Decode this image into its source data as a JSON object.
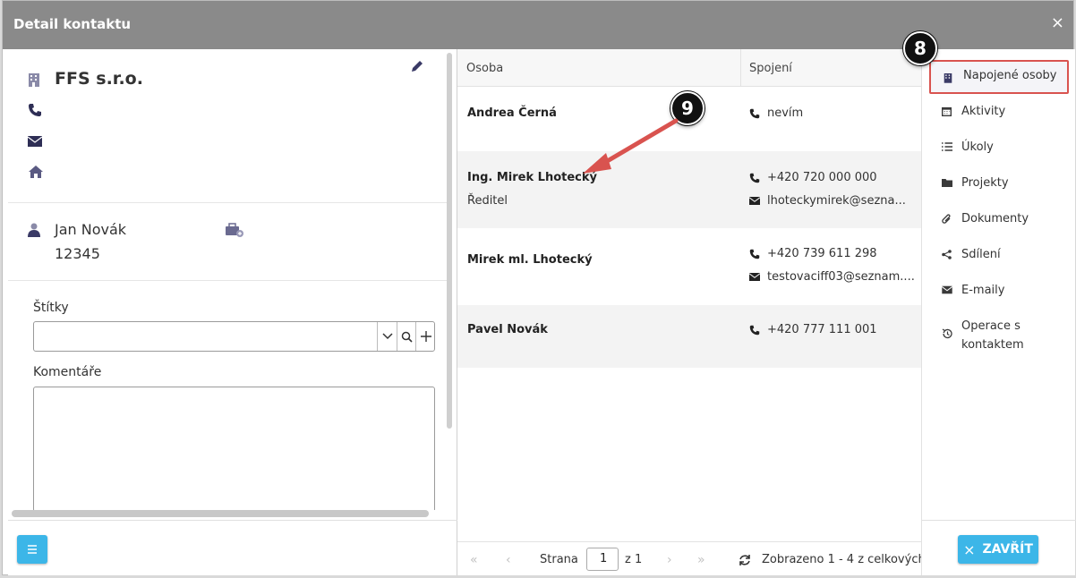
{
  "dialog": {
    "title": "Detail kontaktu",
    "close_symbol": "×"
  },
  "company": {
    "name": "FFS s.r.o."
  },
  "person": {
    "name": "Jan Novák",
    "number": "12345"
  },
  "tags": {
    "label": "Štítky",
    "value": ""
  },
  "comments": {
    "label": "Komentáře",
    "value": ""
  },
  "grid": {
    "columns": [
      "Osoba",
      "Spojení"
    ],
    "rows": [
      {
        "name": "Andrea Černá",
        "role": "",
        "phone": "nevím",
        "email": ""
      },
      {
        "name": "Ing. Mirek Lhotecký",
        "role": "Ředitel",
        "phone": "+420 720 000 000",
        "email": "lhoteckymirek@sezna..."
      },
      {
        "name": "Mirek ml. Lhotecký",
        "role": "",
        "phone": "+420 739 611 298",
        "email": "testovaciff03@seznam...."
      },
      {
        "name": "Pavel Novák",
        "role": "",
        "phone": "+420 777 111 001",
        "email": ""
      }
    ]
  },
  "pager": {
    "page_label": "Strana",
    "page": "1",
    "of_label": "z 1",
    "summary": "Zobrazeno 1 - 4 z celkových"
  },
  "nav": {
    "items": [
      {
        "label": "Napojené osoby",
        "icon": "building-icon",
        "active": true
      },
      {
        "label": "Aktivity",
        "icon": "calendar-icon"
      },
      {
        "label": "Úkoly",
        "icon": "list-icon"
      },
      {
        "label": "Projekty",
        "icon": "folder-icon"
      },
      {
        "label": "Dokumenty",
        "icon": "paperclip-icon"
      },
      {
        "label": "Sdílení",
        "icon": "share-icon"
      },
      {
        "label": "E-maily",
        "icon": "envelope-icon"
      },
      {
        "label": "Operace s kontaktem",
        "icon": "history-icon"
      }
    ],
    "close_label": "ZAVŘÍT",
    "close_icon": "×"
  },
  "annotations": {
    "badge_nav": "8",
    "badge_row": "9"
  },
  "colors": {
    "accent": "#3cb6e8",
    "highlight": "#d9534f",
    "titlebar": "#8a8a8a",
    "icon": "#4a4a6a"
  }
}
